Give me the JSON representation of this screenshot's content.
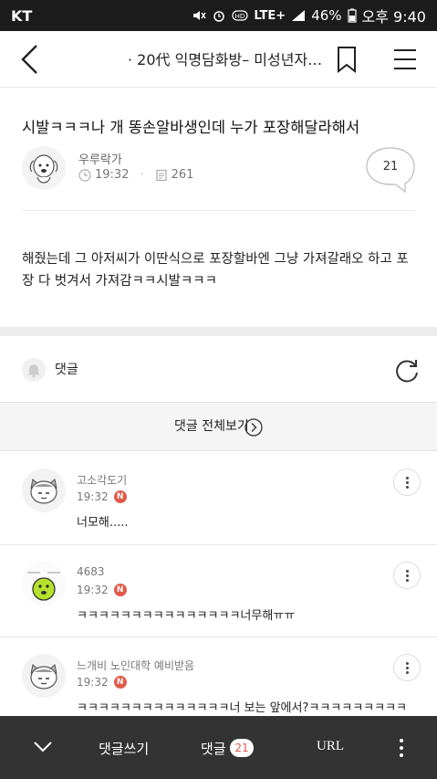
{
  "status_bar": {
    "carrier": "KT",
    "network": "LTE+",
    "battery": "46%",
    "time": "오후 9:40",
    "icons": [
      "mute-icon",
      "alarm-icon",
      "hd-icon",
      "signal-icon",
      "battery-icon"
    ]
  },
  "top_bar": {
    "title": "· 20代 익명담화방– 미성년자…",
    "icons": [
      "back-icon",
      "bookmark-icon",
      "menu-icon"
    ]
  },
  "post": {
    "title": "시발ㅋㅋㅋ나 개 똥손알바생인데 누가 포장해달라해서",
    "author": "우루락가",
    "time": "19:32",
    "views": "261",
    "comment_count": "21",
    "body": "해줬는데 그 아저씨가 이딴식으로 포장할바엔 그냥 가져갈래오 하고 포장 다 벗겨서 가져감ㅋㅋ시발ㅋㅋㅋ"
  },
  "comments_section": {
    "label": "댓글",
    "view_all_label": "댓글 전체보기"
  },
  "comments": [
    {
      "name": "고소각도기",
      "time": "19:32",
      "badge": "N",
      "text": "너모해....."
    },
    {
      "name": "4683",
      "time": "19:32",
      "badge": "N",
      "text": "ㅋㅋㅋㅋㅋㅋㅋㅋㅋㅋㅋㅋㅋㅋㅋ너무해ㅠㅠ"
    },
    {
      "name": "느개비 노인대학 예비받음",
      "time": "19:32",
      "badge": "N",
      "text": "ㅋㅋㅋㅋㅋㅋㅋㅋㅋㅋㅋㅋㅋㅋ너 보는 앞에서?ㅋㅋㅋㅋㅋㅋㅋㅋㅋ"
    }
  ],
  "bottom_bar": {
    "write_label": "댓글쓰기",
    "comments_label": "댓글",
    "comments_count": "21",
    "url_label": "URL"
  },
  "colors": {
    "accent_red": "#e05a4a",
    "bottom_bar_bg": "#333333",
    "status_bar_bg": "#1c1c1c"
  }
}
